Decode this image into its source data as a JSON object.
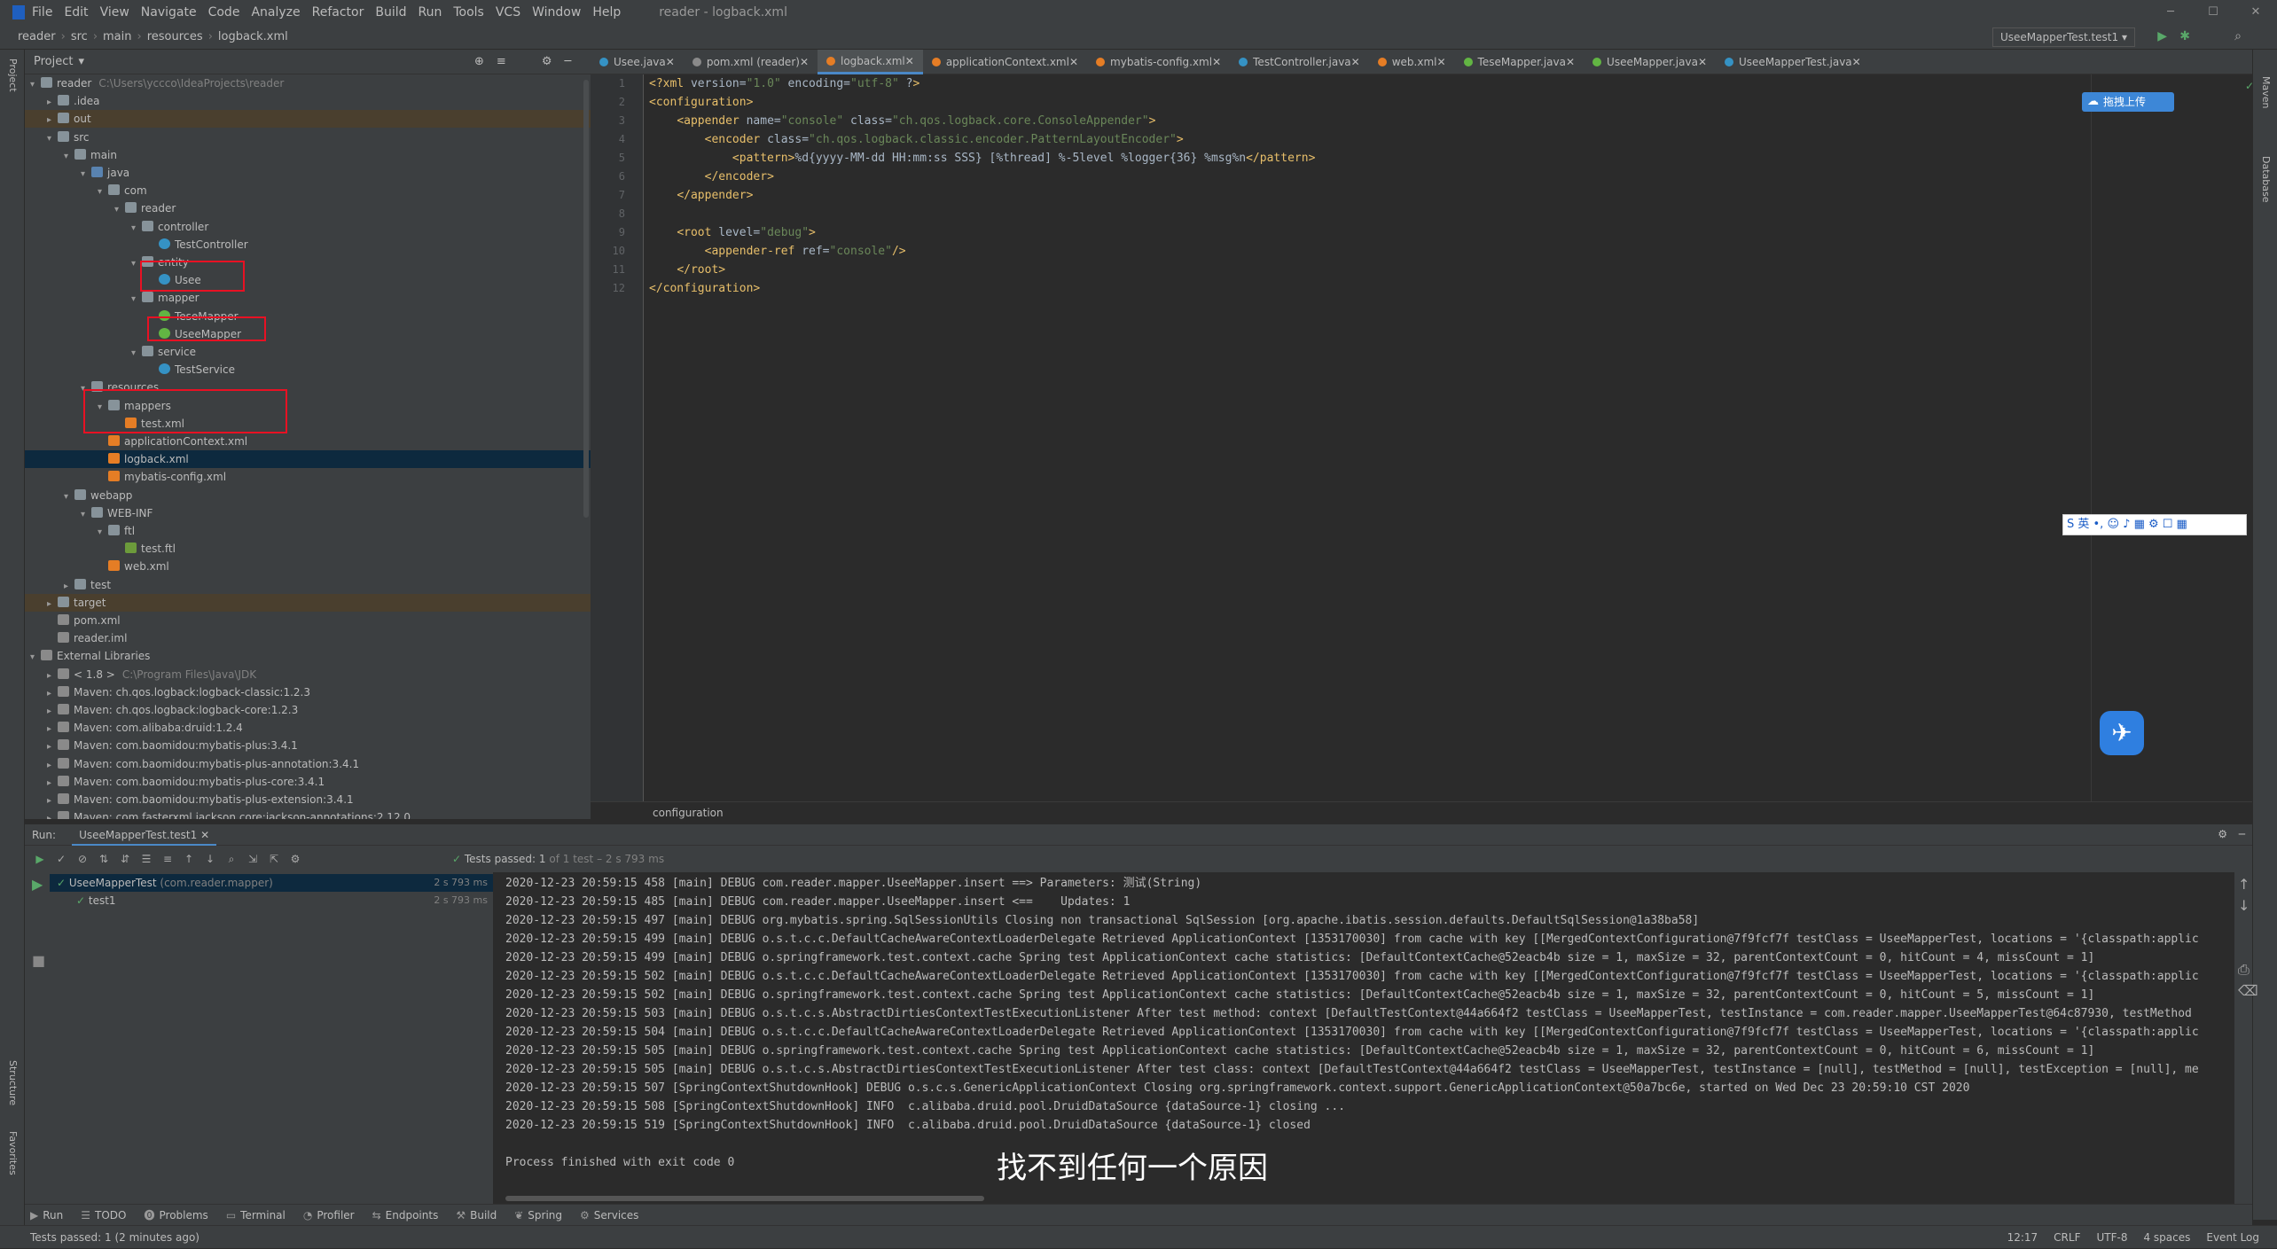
{
  "menubar": {
    "items": [
      "File",
      "Edit",
      "View",
      "Navigate",
      "Code",
      "Analyze",
      "Refactor",
      "Build",
      "Run",
      "Tools",
      "VCS",
      "Window",
      "Help"
    ],
    "window_title": "reader - logback.xml"
  },
  "navbar": {
    "crumbs": [
      "reader",
      "src",
      "main",
      "resources",
      "logback.xml"
    ],
    "run_config": "UseeMapperTest.test1"
  },
  "project": {
    "title": "Project",
    "tree": [
      {
        "label": "reader",
        "extra": "C:\\Users\\yccco\\IdeaProjects\\reader",
        "indent": 0,
        "icon": "dir",
        "arrow": "v"
      },
      {
        "label": ".idea",
        "indent": 1,
        "icon": "dir",
        "arrow": ">"
      },
      {
        "label": "out",
        "indent": 1,
        "icon": "dir",
        "arrow": ">",
        "style": "excl"
      },
      {
        "label": "src",
        "indent": 1,
        "icon": "dir",
        "arrow": "v"
      },
      {
        "label": "main",
        "indent": 2,
        "icon": "dir",
        "arrow": "v"
      },
      {
        "label": "java",
        "indent": 3,
        "icon": "src",
        "arrow": "v"
      },
      {
        "label": "com",
        "indent": 4,
        "icon": "dir",
        "arrow": "v"
      },
      {
        "label": "reader",
        "indent": 5,
        "icon": "dir",
        "arrow": "v"
      },
      {
        "label": "controller",
        "indent": 6,
        "icon": "dir",
        "arrow": "v"
      },
      {
        "label": "TestController",
        "indent": 7,
        "icon": "cls",
        "arrow": ""
      },
      {
        "label": "entity",
        "indent": 6,
        "icon": "dir",
        "arrow": "v"
      },
      {
        "label": "Usee",
        "indent": 7,
        "icon": "cls",
        "arrow": ""
      },
      {
        "label": "mapper",
        "indent": 6,
        "icon": "dir",
        "arrow": "v"
      },
      {
        "label": "TeseMapper",
        "indent": 7,
        "icon": "ifc",
        "arrow": ""
      },
      {
        "label": "UseeMapper",
        "indent": 7,
        "icon": "ifc",
        "arrow": ""
      },
      {
        "label": "service",
        "indent": 6,
        "icon": "dir",
        "arrow": "v"
      },
      {
        "label": "TestService",
        "indent": 7,
        "icon": "cls",
        "arrow": ""
      },
      {
        "label": "resources",
        "indent": 3,
        "icon": "dir",
        "arrow": "v"
      },
      {
        "label": "mappers",
        "indent": 4,
        "icon": "dir",
        "arrow": "v"
      },
      {
        "label": "test.xml",
        "indent": 5,
        "icon": "xml",
        "arrow": ""
      },
      {
        "label": "applicationContext.xml",
        "indent": 4,
        "icon": "xml",
        "arrow": ""
      },
      {
        "label": "logback.xml",
        "indent": 4,
        "icon": "xml",
        "arrow": "",
        "style": "sel"
      },
      {
        "label": "mybatis-config.xml",
        "indent": 4,
        "icon": "xml",
        "arrow": ""
      },
      {
        "label": "webapp",
        "indent": 2,
        "icon": "dir",
        "arrow": "v"
      },
      {
        "label": "WEB-INF",
        "indent": 3,
        "icon": "dir",
        "arrow": "v"
      },
      {
        "label": "ftl",
        "indent": 4,
        "icon": "dir",
        "arrow": "v"
      },
      {
        "label": "test.ftl",
        "indent": 5,
        "icon": "ftl",
        "arrow": ""
      },
      {
        "label": "web.xml",
        "indent": 4,
        "icon": "xml",
        "arrow": ""
      },
      {
        "label": "test",
        "indent": 2,
        "icon": "dir",
        "arrow": ">"
      },
      {
        "label": "target",
        "indent": 1,
        "icon": "dir",
        "arrow": ">",
        "style": "excl"
      },
      {
        "label": "pom.xml",
        "indent": 1,
        "icon": "lib",
        "arrow": ""
      },
      {
        "label": "reader.iml",
        "indent": 1,
        "icon": "lib",
        "arrow": ""
      },
      {
        "label": "External Libraries",
        "indent": 0,
        "icon": "lib",
        "arrow": "v"
      },
      {
        "label": "< 1.8 >",
        "extra": "C:\\Program Files\\Java\\JDK",
        "indent": 1,
        "icon": "lib",
        "arrow": ">"
      },
      {
        "label": "Maven: ch.qos.logback:logback-classic:1.2.3",
        "indent": 1,
        "icon": "lib",
        "arrow": ">"
      },
      {
        "label": "Maven: ch.qos.logback:logback-core:1.2.3",
        "indent": 1,
        "icon": "lib",
        "arrow": ">"
      },
      {
        "label": "Maven: com.alibaba:druid:1.2.4",
        "indent": 1,
        "icon": "lib",
        "arrow": ">"
      },
      {
        "label": "Maven: com.baomidou:mybatis-plus:3.4.1",
        "indent": 1,
        "icon": "lib",
        "arrow": ">"
      },
      {
        "label": "Maven: com.baomidou:mybatis-plus-annotation:3.4.1",
        "indent": 1,
        "icon": "lib",
        "arrow": ">"
      },
      {
        "label": "Maven: com.baomidou:mybatis-plus-core:3.4.1",
        "indent": 1,
        "icon": "lib",
        "arrow": ">"
      },
      {
        "label": "Maven: com.baomidou:mybatis-plus-extension:3.4.1",
        "indent": 1,
        "icon": "lib",
        "arrow": ">"
      },
      {
        "label": "Maven: com.fasterxml.jackson.core:jackson-annotations:2.12.0",
        "indent": 1,
        "icon": "lib",
        "arrow": ">"
      }
    ]
  },
  "editor": {
    "tabs": [
      {
        "label": "Usee.java",
        "color": "#3592c4"
      },
      {
        "label": "pom.xml (reader)",
        "color": "#8a8a8a"
      },
      {
        "label": "logback.xml",
        "color": "#e57d25",
        "active": true
      },
      {
        "label": "applicationContext.xml",
        "color": "#e57d25"
      },
      {
        "label": "mybatis-config.xml",
        "color": "#e57d25"
      },
      {
        "label": "TestController.java",
        "color": "#3592c4"
      },
      {
        "label": "web.xml",
        "color": "#e57d25"
      },
      {
        "label": "TeseMapper.java",
        "color": "#62b543"
      },
      {
        "label": "UseeMapper.java",
        "color": "#62b543"
      },
      {
        "label": "UseeMapperTest.java",
        "color": "#3592c4"
      }
    ],
    "code_lines": [
      "<?xml version=\"1.0\" encoding=\"utf-8\" ?>",
      "<configuration>",
      "    <appender name=\"console\" class=\"ch.qos.logback.core.ConsoleAppender\">",
      "        <encoder class=\"ch.qos.logback.classic.encoder.PatternLayoutEncoder\">",
      "            <pattern>%d{yyyy-MM-dd HH:mm:ss SSS} [%thread] %-5level %logger{36} %msg%n</pattern>",
      "        </encoder>",
      "    </appender>",
      "",
      "    <root level=\"debug\">",
      "        <appender-ref ref=\"console\"/>",
      "    </root>",
      "</configuration>"
    ],
    "breadcrumb": "configuration"
  },
  "run": {
    "label": "Run:",
    "tab": "UseeMapperTest.test1",
    "status_prefix": "Tests passed:",
    "status_count": "1",
    "status_suffix": "of 1 test – 2 s 793 ms",
    "tests": [
      {
        "name": "UseeMapperTest",
        "pkg": "(com.reader.mapper)",
        "time": "2 s 793 ms",
        "indent": 0
      },
      {
        "name": "test1",
        "pkg": "",
        "time": "2 s 793 ms",
        "indent": 1
      }
    ],
    "console": [
      "2020-12-23 20:59:15 458 [main] DEBUG com.reader.mapper.UseeMapper.insert ==> Parameters: 测试(String)",
      "2020-12-23 20:59:15 485 [main] DEBUG com.reader.mapper.UseeMapper.insert <==    Updates: 1",
      "2020-12-23 20:59:15 497 [main] DEBUG org.mybatis.spring.SqlSessionUtils Closing non transactional SqlSession [org.apache.ibatis.session.defaults.DefaultSqlSession@1a38ba58]",
      "2020-12-23 20:59:15 499 [main] DEBUG o.s.t.c.c.DefaultCacheAwareContextLoaderDelegate Retrieved ApplicationContext [1353170030] from cache with key [[MergedContextConfiguration@7f9fcf7f testClass = UseeMapperTest, locations = '{classpath:applic",
      "2020-12-23 20:59:15 499 [main] DEBUG o.springframework.test.context.cache Spring test ApplicationContext cache statistics: [DefaultContextCache@52eacb4b size = 1, maxSize = 32, parentContextCount = 0, hitCount = 4, missCount = 1]",
      "2020-12-23 20:59:15 502 [main] DEBUG o.s.t.c.c.DefaultCacheAwareContextLoaderDelegate Retrieved ApplicationContext [1353170030] from cache with key [[MergedContextConfiguration@7f9fcf7f testClass = UseeMapperTest, locations = '{classpath:applic",
      "2020-12-23 20:59:15 502 [main] DEBUG o.springframework.test.context.cache Spring test ApplicationContext cache statistics: [DefaultContextCache@52eacb4b size = 1, maxSize = 32, parentContextCount = 0, hitCount = 5, missCount = 1]",
      "2020-12-23 20:59:15 503 [main] DEBUG o.s.t.c.s.AbstractDirtiesContextTestExecutionListener After test method: context [DefaultTestContext@44a664f2 testClass = UseeMapperTest, testInstance = com.reader.mapper.UseeMapperTest@64c87930, testMethod",
      "2020-12-23 20:59:15 504 [main] DEBUG o.s.t.c.c.DefaultCacheAwareContextLoaderDelegate Retrieved ApplicationContext [1353170030] from cache with key [[MergedContextConfiguration@7f9fcf7f testClass = UseeMapperTest, locations = '{classpath:applic",
      "2020-12-23 20:59:15 505 [main] DEBUG o.springframework.test.context.cache Spring test ApplicationContext cache statistics: [DefaultContextCache@52eacb4b size = 1, maxSize = 32, parentContextCount = 0, hitCount = 6, missCount = 1]",
      "2020-12-23 20:59:15 505 [main] DEBUG o.s.t.c.s.AbstractDirtiesContextTestExecutionListener After test class: context [DefaultTestContext@44a664f2 testClass = UseeMapperTest, testInstance = [null], testMethod = [null], testException = [null], me",
      "2020-12-23 20:59:15 507 [SpringContextShutdownHook] DEBUG o.s.c.s.GenericApplicationContext Closing org.springframework.context.support.GenericApplicationContext@50a7bc6e, started on Wed Dec 23 20:59:10 CST 2020",
      "2020-12-23 20:59:15 508 [SpringContextShutdownHook] INFO  c.alibaba.druid.pool.DruidDataSource {dataSource-1} closing ...",
      "2020-12-23 20:59:15 519 [SpringContextShutdownHook] INFO  c.alibaba.druid.pool.DruidDataSource {dataSource-1} closed",
      "",
      "Process finished with exit code 0"
    ]
  },
  "subtitle": "找不到任何一个原因",
  "overlays": {
    "upload_label": "拖拽上传",
    "ime_label": "S 英 •, ☺ ♪ ▦ ⚙ ☐ ▦"
  },
  "bottom_tabs": [
    "Run",
    "TODO",
    "Problems",
    "Terminal",
    "Profiler",
    "Endpoints",
    "Build",
    "Spring",
    "Services"
  ],
  "status": {
    "message": "Tests passed: 1 (2 minutes ago)",
    "position": "12:17",
    "line_sep": "CRLF",
    "encoding": "UTF-8",
    "indent": "4 spaces",
    "event_log": "Event Log"
  },
  "side": {
    "project": "Project",
    "structure": "Structure",
    "favorites": "Favorites",
    "maven": "Maven",
    "database": "Database"
  }
}
